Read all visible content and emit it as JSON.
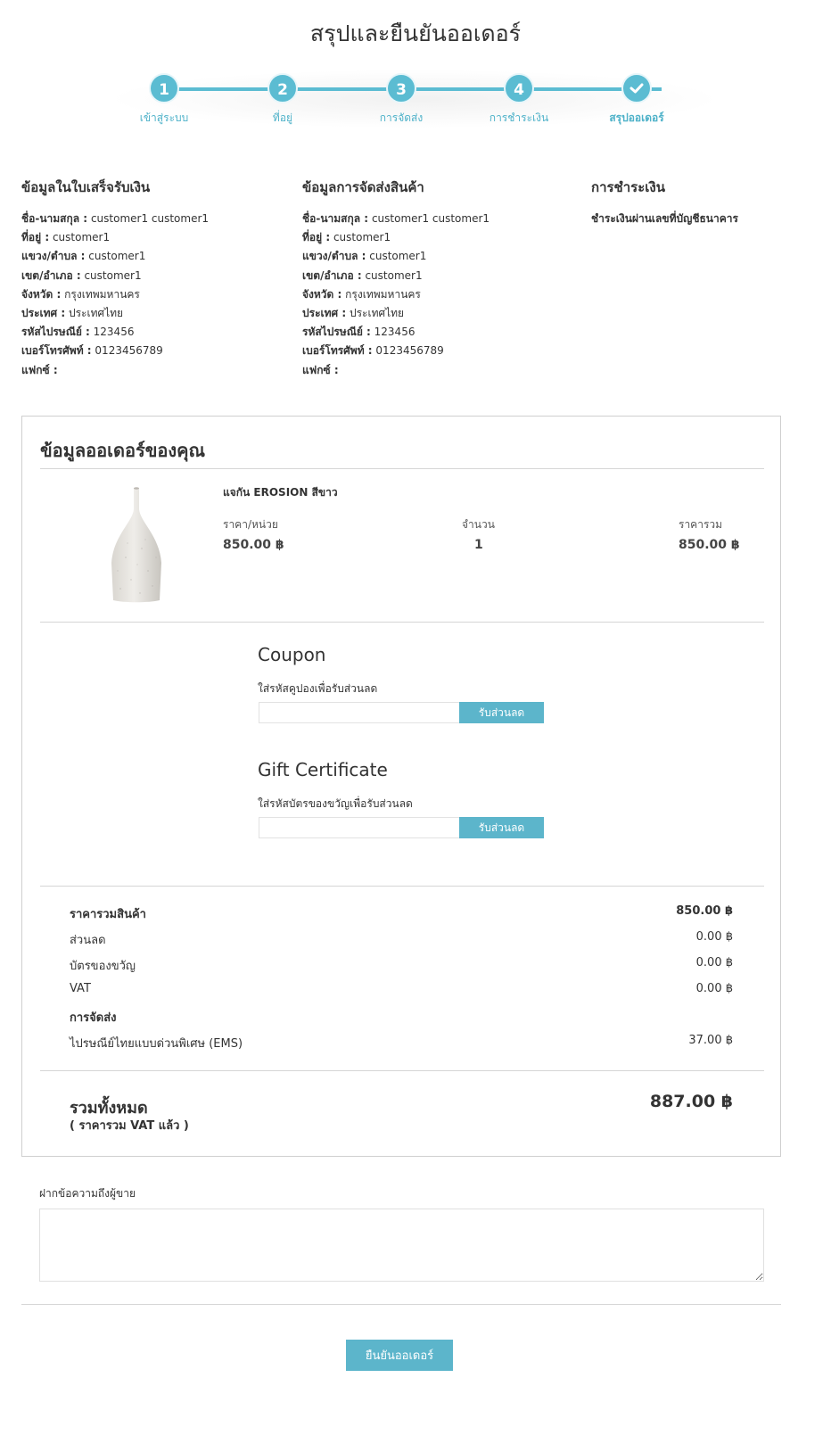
{
  "page_title": "สรุปและยืนยันออเดอร์",
  "steps": [
    {
      "number": "1",
      "label": "เข้าสู่ระบบ"
    },
    {
      "number": "2",
      "label": "ที่อยู่"
    },
    {
      "number": "3",
      "label": "การจัดส่ง"
    },
    {
      "number": "4",
      "label": "การชำระเงิน"
    },
    {
      "number": "",
      "label": "สรุปออเดอร์",
      "icon": "check-icon"
    }
  ],
  "billing": {
    "title": "ข้อมูลในใบเสร็จรับเงิน",
    "rows": [
      {
        "label": "ชื่อ-นามสกุล :",
        "value": "customer1 customer1"
      },
      {
        "label": "ที่อยู่ :",
        "value": "customer1"
      },
      {
        "label": "แขวง/ตำบล :",
        "value": "customer1"
      },
      {
        "label": "เขต/อำเภอ :",
        "value": "customer1"
      },
      {
        "label": "จังหวัด :",
        "value": "กรุงเทพมหานคร"
      },
      {
        "label": "ประเทศ :",
        "value": "ประเทศไทย"
      },
      {
        "label": "รหัสไปรษณีย์ :",
        "value": "123456"
      },
      {
        "label": "เบอร์โทรศัพท์ :",
        "value": "0123456789"
      },
      {
        "label": "แฟกซ์ :",
        "value": ""
      }
    ]
  },
  "shipping": {
    "title": "ข้อมูลการจัดส่งสินค้า",
    "rows": [
      {
        "label": "ชื่อ-นามสกุล :",
        "value": "customer1 customer1"
      },
      {
        "label": "ที่อยู่ :",
        "value": "customer1"
      },
      {
        "label": "แขวง/ตำบล :",
        "value": "customer1"
      },
      {
        "label": "เขต/อำเภอ :",
        "value": "customer1"
      },
      {
        "label": "จังหวัด :",
        "value": "กรุงเทพมหานคร"
      },
      {
        "label": "ประเทศ :",
        "value": "ประเทศไทย"
      },
      {
        "label": "รหัสไปรษณีย์ :",
        "value": "123456"
      },
      {
        "label": "เบอร์โทรศัพท์ :",
        "value": "0123456789"
      },
      {
        "label": "แฟกซ์ :",
        "value": ""
      }
    ]
  },
  "payment": {
    "title": "การชำระเงิน",
    "method": "ชำระเงินผ่านเลขที่บัญชีธนาคาร"
  },
  "order": {
    "title": "ข้อมูลออเดอร์ของคุณ",
    "product": {
      "name": "แจกัน EROSION สีขาว",
      "unit_price_label": "ราคา/หน่วย",
      "unit_price": "850.00 ฿",
      "qty_label": "จำนวน",
      "qty": "1",
      "total_label": "ราคารวม",
      "total": "850.00 ฿"
    },
    "coupon": {
      "title": "Coupon",
      "help": "ใส่รหัสคูปองเพื่อรับส่วนลด",
      "value": "",
      "button": "รับส่วนลด"
    },
    "gift": {
      "title": "Gift Certificate",
      "help": "ใส่รหัสบัตรของขวัญเพื่อรับส่วนลด",
      "value": "",
      "button": "รับส่วนลด"
    },
    "summary": {
      "subtotal_label": "ราคารวมสินค้า",
      "subtotal": "850.00 ฿",
      "discount_label": "ส่วนลด",
      "discount": "0.00 ฿",
      "gift_label": "บัตรของขวัญ",
      "gift": "0.00 ฿",
      "vat_label": "VAT",
      "vat": "0.00 ฿",
      "shipping_label": "การจัดส่ง",
      "shipping_method": "ไปรษณีย์ไทยแบบด่วนพิเศษ (EMS)",
      "shipping": "37.00 ฿"
    },
    "grand": {
      "label": "รวมทั้งหมด",
      "sub": "( ราคารวม VAT แล้ว )",
      "value": "887.00 ฿"
    }
  },
  "message": {
    "label": "ฝากข้อความถึงผู้ขาย",
    "value": ""
  },
  "confirm_button": "ยืนยันออเดอร์",
  "colors": {
    "accent": "#5bbcd2",
    "button": "#5cb5cb"
  }
}
